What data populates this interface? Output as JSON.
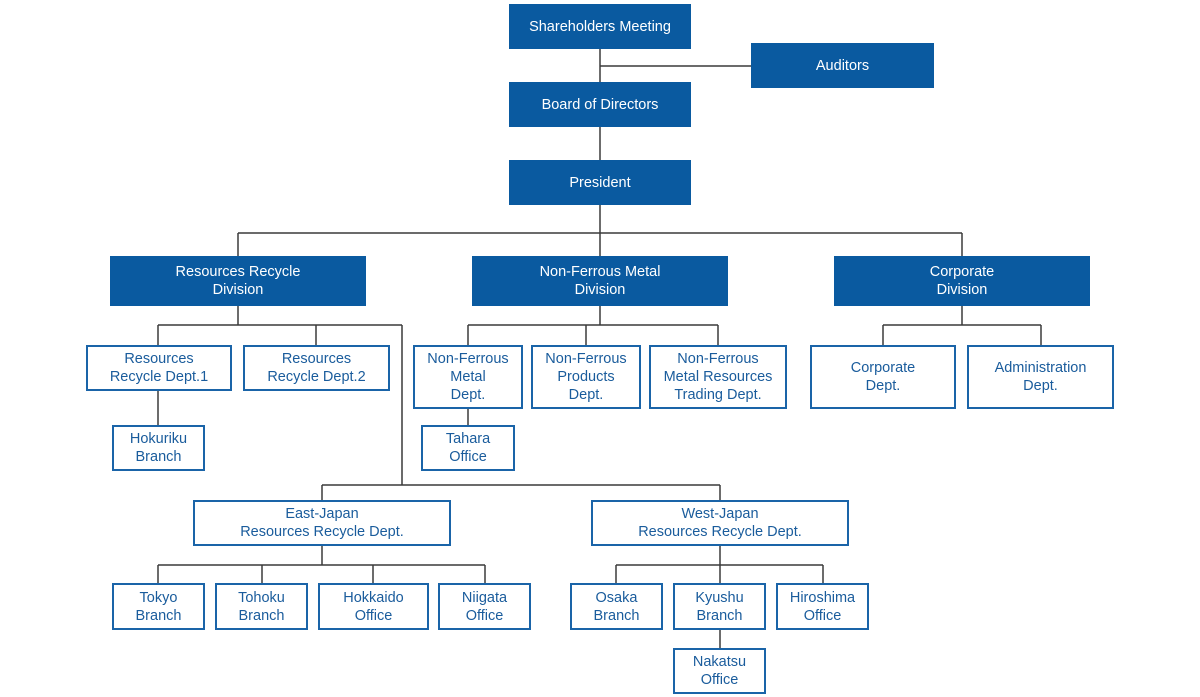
{
  "colors": {
    "filled_box": "#0a5aa0",
    "outlined_border": "#1a64a8",
    "outlined_text": "#1a5c9c",
    "connector": "#3a3a3a"
  },
  "nodes": {
    "shareholders": "Shareholders Meeting",
    "auditors": "Auditors",
    "board": "Board of Directors",
    "president": "President",
    "rr_division": "Resources Recycle\nDivision",
    "nf_division": "Non-Ferrous Metal\nDivision",
    "corp_division": "Corporate\nDivision",
    "rr_dept1": "Resources\nRecycle Dept.1",
    "rr_dept2": "Resources\nRecycle Dept.2",
    "hokuriku": "Hokuriku\nBranch",
    "nf_metal": "Non-Ferrous\nMetal\nDept.",
    "nf_products": "Non-Ferrous\nProducts\nDept.",
    "nf_trading": "Non-Ferrous\nMetal Resources\nTrading Dept.",
    "tahara": "Tahara\nOffice",
    "corp_dept": "Corporate\nDept.",
    "admin_dept": "Administration\nDept.",
    "east_japan": "East-Japan\nResources Recycle Dept.",
    "west_japan": "West-Japan\nResources Recycle Dept.",
    "tokyo": "Tokyo\nBranch",
    "tohoku": "Tohoku\nBranch",
    "hokkaido": "Hokkaido\nOffice",
    "niigata": "Niigata\nOffice",
    "osaka": "Osaka\nBranch",
    "kyushu": "Kyushu\nBranch",
    "hiroshima": "Hiroshima\nOffice",
    "nakatsu": "Nakatsu\nOffice"
  }
}
